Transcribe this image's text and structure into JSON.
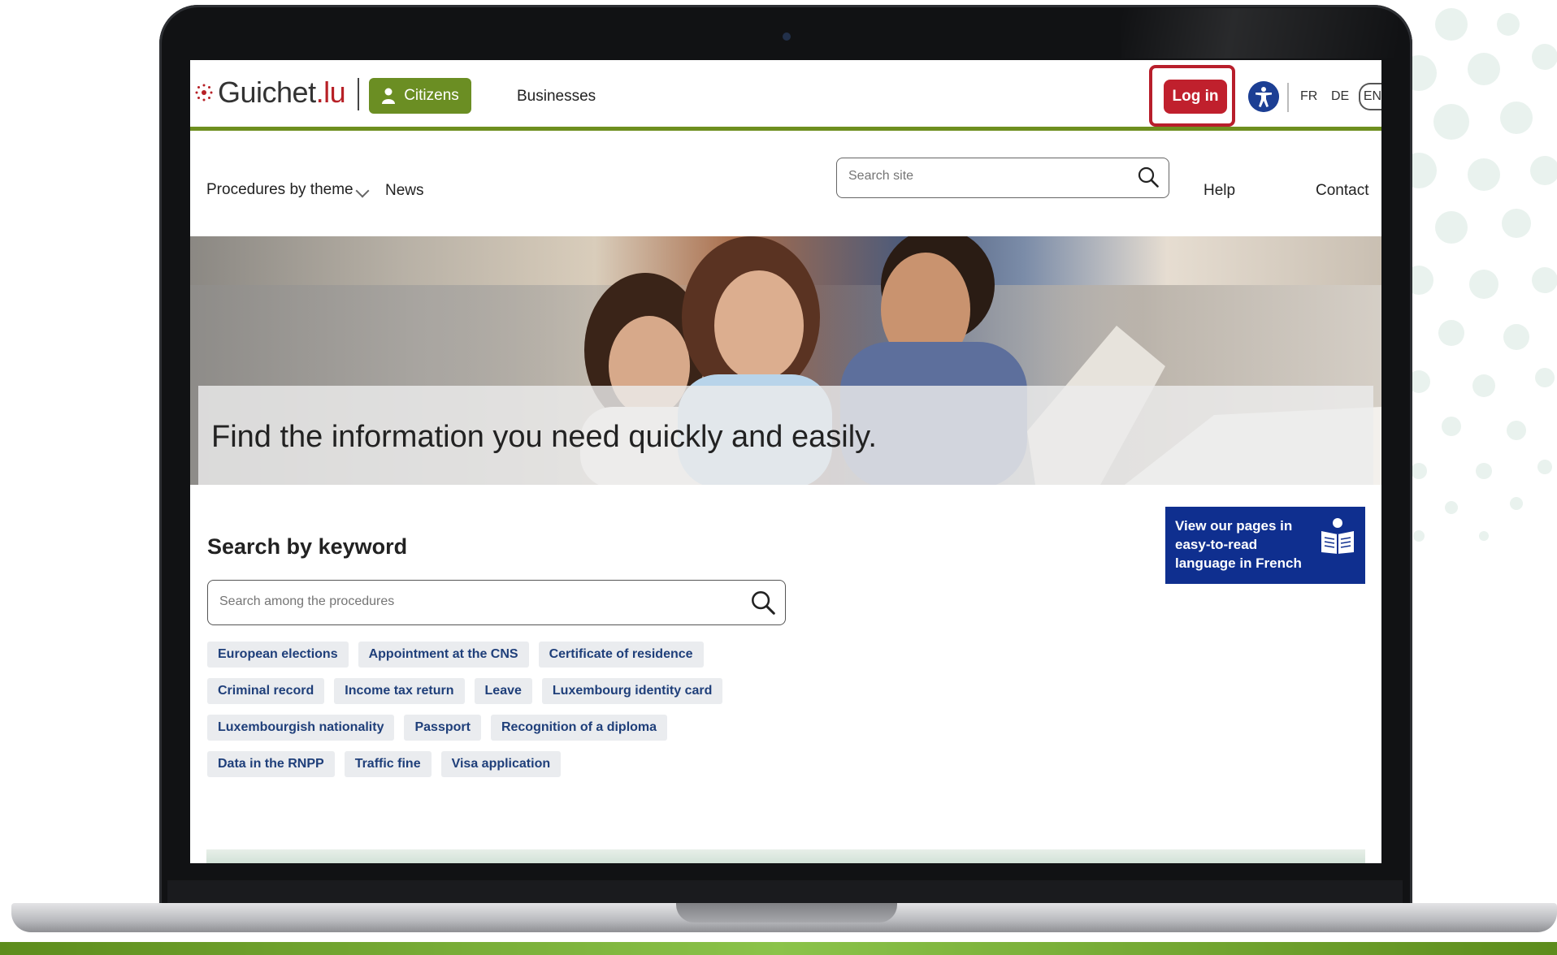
{
  "header": {
    "logo_text": "Guichet",
    "logo_suffix": ".lu",
    "citizens_label": "Citizens",
    "businesses_label": "Businesses",
    "login_label": "Log in",
    "languages": [
      "FR",
      "DE",
      "EN"
    ]
  },
  "nav": {
    "procedures_label": "Procedures by theme",
    "news_label": "News",
    "search_placeholder": "Search site",
    "help_label": "Help",
    "contact_label": "Contact"
  },
  "hero": {
    "title": "Find the information you need quickly and easily."
  },
  "main": {
    "section_title": "Search by keyword",
    "search_placeholder": "Search among the procedures",
    "tags": [
      [
        "European elections",
        "Appointment at the CNS",
        "Certificate of residence"
      ],
      [
        "Criminal record",
        "Income tax return",
        "Leave",
        "Luxembourg identity card"
      ],
      [
        "Luxembourgish nationality",
        "Passport",
        "Recognition of a diploma"
      ],
      [
        "Data in the RNPP",
        "Traffic fine",
        "Visa application"
      ]
    ],
    "easy_read": "View our pages in easy-to-read language in French"
  },
  "icons": [
    "user-icon",
    "search-icon",
    "accessibility-icon",
    "easy-read-icon",
    "chevron-down-icon",
    "logo-mark-icon"
  ],
  "colors": {
    "brand_green": "#6b8e23",
    "login_red": "#c0202d",
    "accessibility_blue": "#1c3f94",
    "easy_read_blue": "#0f2f8f",
    "tag_text": "#1f3f7a"
  }
}
